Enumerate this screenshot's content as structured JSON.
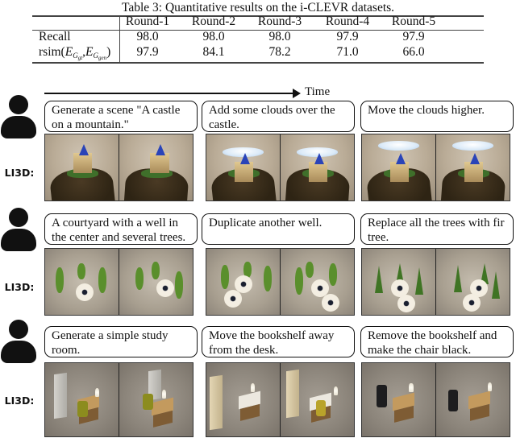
{
  "table": {
    "caption": "Table 3: Quantitative results on the i-CLEVR datasets.",
    "columns": [
      "",
      "Round-1",
      "Round-2",
      "Round-3",
      "Round-4",
      "Round-5"
    ],
    "rows": [
      {
        "label": "Recall",
        "values": [
          "98.0",
          "98.0",
          "98.0",
          "97.9",
          "97.9"
        ]
      },
      {
        "label_prefix": "rsim(",
        "label_e1": "E",
        "label_g1": "G",
        "label_s1": "gt",
        "label_comma": ",",
        "label_e2": "E",
        "label_g2": "G",
        "label_s2": "gen",
        "label_suffix": ")",
        "values": [
          "97.9",
          "84.1",
          "78.2",
          "71.0",
          "66.0"
        ]
      }
    ]
  },
  "figure": {
    "time_label": "Time",
    "model_label": "LI3D:",
    "user_icon": "user-icon",
    "rows": [
      {
        "scene": "castle",
        "prompts": [
          "Generate a scene \"A castle on a mountain.\"",
          "Add some clouds over the castle.",
          "Move the clouds higher."
        ]
      },
      {
        "scene": "courtyard",
        "prompts": [
          "A courtyard with a well in the center and several trees.",
          "Duplicate another well.",
          "Replace all the trees with fir tree."
        ]
      },
      {
        "scene": "study-room",
        "prompts": [
          "Generate a simple study room.",
          "Move the bookshelf away from the desk.",
          "Remove the bookshelf and make the chair black."
        ]
      }
    ]
  }
}
